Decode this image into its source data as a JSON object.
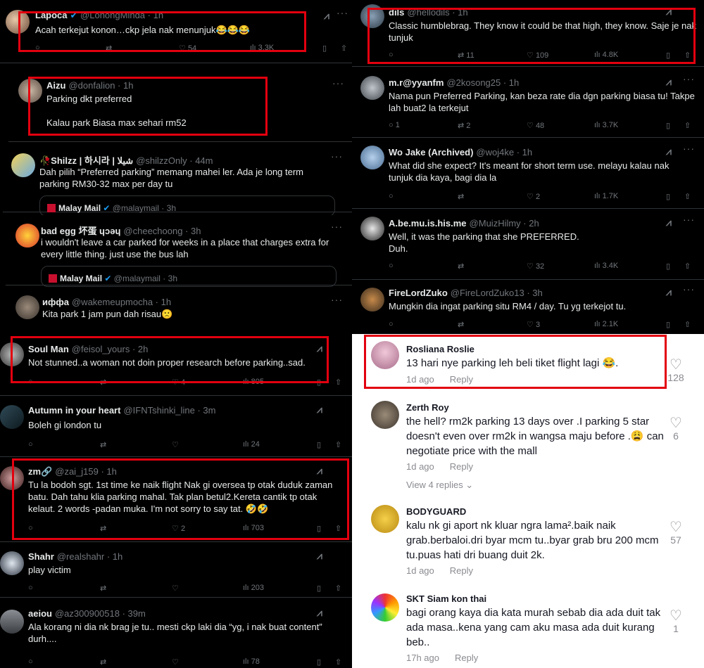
{
  "top_left": [
    {
      "name": "Lapoca",
      "handle": "@LohongMinda · 1h",
      "text": "Acah terkejut konon…ckp jela nak menunjuk😂😂😂",
      "replies": "",
      "reposts": "",
      "likes": "54",
      "views": "3.3K"
    },
    {
      "name": "Aizu",
      "handle": "@donfalion · 1h",
      "text": "Parking dkt preferred\n\nKalau park Biasa max sehari rm52"
    },
    {
      "name": "🥀Shilzz | 하시라 | شيلا",
      "handle": "@shilzzOnly · 44m",
      "text": "Dah pilih “Preferred parking” memang mahei ler. Ada je long term parking RM30-32 max per day tu",
      "quote_name": "Malay Mail",
      "quote_handle": "@malaymail · 3h"
    },
    {
      "name": "bad egg 坏蛋 ɥɔǝɥ",
      "handle": "@cheechoong · 3h",
      "text": "i wouldn't leave a car parked for weeks in a place that charges extra for every little thing. just use the bus lah",
      "quote_name": "Malay Mail",
      "quote_handle": "@malaymail · 3h"
    },
    {
      "name": "иффа",
      "handle": "@wakemeupmocha · 1h",
      "text": "Kita park 1 jam pun dah risau🙁"
    }
  ],
  "top_right": [
    {
      "name": "dils",
      "handle": "@hellodils · 1h",
      "text": "Classic humblebrag. They know it could be that high, they know. Saje je nak tunjuk",
      "replies": "",
      "reposts": "11",
      "likes": "109",
      "views": "4.8K"
    },
    {
      "name": "m.r@yyanfm",
      "handle": "@2kosong25 · 1h",
      "text": "Nama pun Preferred Parking, kan beza rate dia dgn parking biasa tu! Takpe lah buat2 la terkejut",
      "replies": "1",
      "reposts": "2",
      "likes": "48",
      "views": "3.7K"
    },
    {
      "name": "Wo Jake (Archived)",
      "handle": "@woj4ke · 1h",
      "text": "What did she expect? It's meant for short term use. melayu kalau nak tunjuk dia kaya, bagi dia la",
      "replies": "",
      "reposts": "",
      "likes": "2",
      "views": "1.7K"
    },
    {
      "name": "A.be.mu.is.his.me",
      "handle": "@MuizHilmy · 2h",
      "text": "Well, it was the parking that she PREFERRED.\nDuh.",
      "replies": "",
      "reposts": "",
      "likes": "32",
      "views": "3.4K"
    },
    {
      "name": "FireLordZuko",
      "handle": "@FireLordZuko13 · 3h",
      "text": "Mungkin dia ingat parking situ RM4 / day. Tu yg terkejot tu.",
      "replies": "",
      "reposts": "",
      "likes": "3",
      "views": "2.1K"
    }
  ],
  "bottom_left": [
    {
      "name": "Soul Man",
      "handle": "@feisol_yours · 2h",
      "text": "Not stunned..a woman not doin proper research before parking..sad.",
      "replies": "",
      "reposts": "",
      "likes": "4",
      "views": "805"
    },
    {
      "name": "Autumn in your heart",
      "handle": "@IFNTshinki_line · 3m",
      "text": "Boleh gi london tu",
      "replies": "",
      "reposts": "",
      "likes": "",
      "views": "24"
    },
    {
      "name": "zm🔗",
      "handle": "@zai_j159 · 1h",
      "text": "Tu la bodoh sgt. 1st time ke naik flight Nak gi oversea tp otak duduk zaman batu. Dah tahu klia parking mahal. Tak plan betul2.Kereta cantik tp otak kelaut. 2 words -padan muka. I'm not sorry to say tat. 🤣🤣",
      "replies": "",
      "reposts": "",
      "likes": "2",
      "views": "703"
    },
    {
      "name": "Shahr",
      "handle": "@realshahr · 1h",
      "text": "play victim",
      "replies": "",
      "reposts": "",
      "likes": "",
      "views": "203"
    },
    {
      "name": "aeiou",
      "handle": "@az300900518 · 39m",
      "text": "Ala korang ni dia nk brag je tu.. mesti ckp laki dia “yg, i nak buat content” durh....",
      "replies": "",
      "reposts": "",
      "likes": "",
      "views": "78"
    }
  ],
  "comments": [
    {
      "name": "Rosliana Roslie",
      "text": "13 hari nye parking leh beli tiket flight lagi 😂.",
      "time": "1d ago",
      "reply": "Reply",
      "likes": "128"
    },
    {
      "name": "Zerth Roy",
      "text": "the hell? rm2k parking 13 days over .I parking 5 star doesn't even over rm2k in wangsa maju before .😩 can negotiate price with the mall",
      "time": "1d ago",
      "reply": "Reply",
      "likes": "6",
      "view_replies": "View 4 replies ⌄"
    },
    {
      "name": "BODYGUARD",
      "text": "kalu nk gi aport nk kluar ngra lama².baik naik grab.berbaloi.dri byar mcm tu..byar grab bru 200 mcm tu.puas hati dri buang duit 2k.",
      "time": "1d ago",
      "reply": "Reply",
      "likes": "57"
    },
    {
      "name": "SKT Siam kon thai",
      "text": "bagi orang kaya dia kata murah sebab dia ada duit tak ada masa..kena yang cam aku masa ada duit kurang beb..",
      "time": "17h ago",
      "reply": "Reply",
      "likes": "1"
    }
  ],
  "icons": {
    "reply": "○",
    "repost": "⇄",
    "like": "♡",
    "views": "ılı",
    "bookmark": "▯",
    "share": "⇧",
    "more": "···",
    "grok": "⩘",
    "heart_outline": "♡"
  },
  "colors": {
    "highlight": "#e3000f",
    "dark_bg": "#000000",
    "muted": "#71767b"
  }
}
